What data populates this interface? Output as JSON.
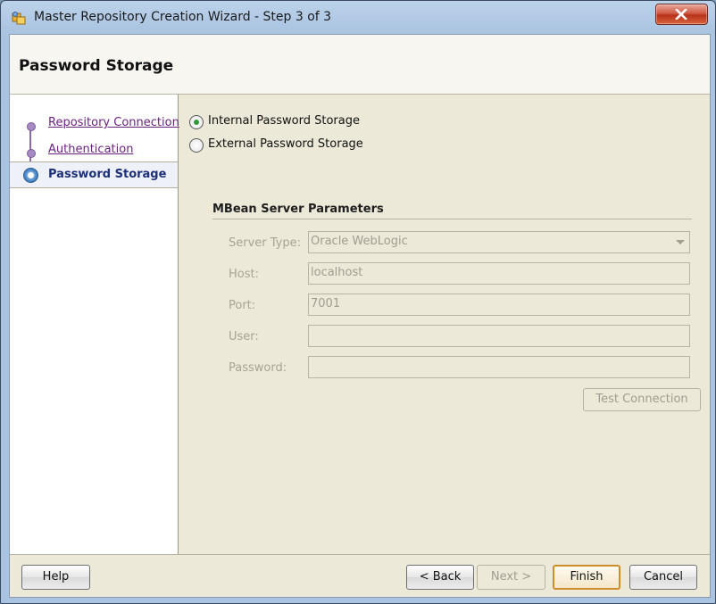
{
  "window": {
    "title": "Master Repository Creation Wizard - Step 3 of 3"
  },
  "header": {
    "title": "Password Storage"
  },
  "steps": [
    {
      "label": "Repository Connection"
    },
    {
      "label": "Authentication"
    },
    {
      "label": "Password Storage",
      "current": true
    }
  ],
  "storage_options": [
    {
      "label": "Internal Password Storage",
      "checked": true
    },
    {
      "label": "External Password Storage",
      "checked": false
    }
  ],
  "mbean": {
    "section_title": "MBean Server Parameters",
    "server_type": {
      "label": "Server Type:",
      "value": "Oracle WebLogic"
    },
    "host": {
      "label": "Host:",
      "value": "localhost"
    },
    "port": {
      "label": "Port:",
      "value": "7001"
    },
    "user": {
      "label": "User:",
      "value": ""
    },
    "password": {
      "label": "Password:",
      "value": ""
    },
    "test_connection_label": "Test Connection"
  },
  "footer": {
    "help_label": "Help",
    "back_label": "< Back",
    "next_label": "Next >",
    "finish_label": "Finish",
    "cancel_label": "Cancel"
  },
  "colors": {
    "link": "#6b2380",
    "current_step": "#1d2f7a",
    "radio_checked": "#2e9a3a",
    "default_button_border": "#cd8d2a",
    "close_button": "#c8452b"
  }
}
